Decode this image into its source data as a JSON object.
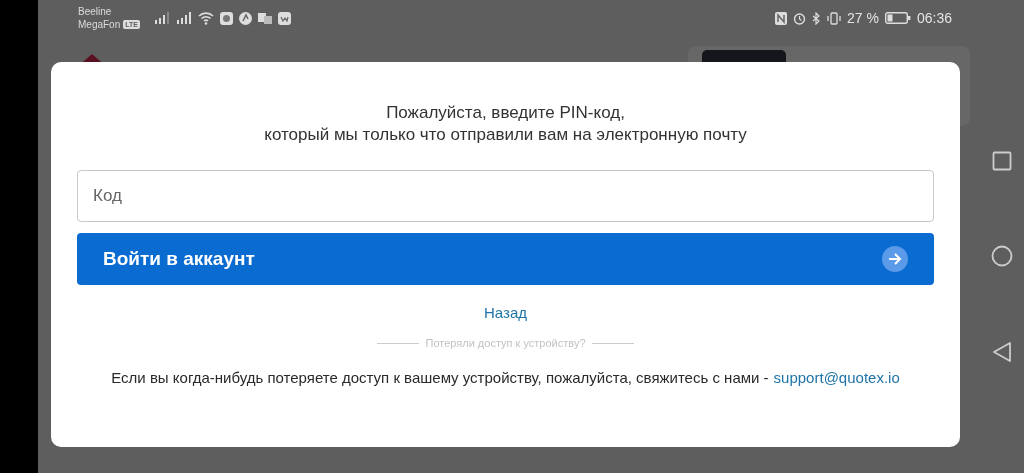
{
  "status_bar": {
    "carriers": [
      "Beeline",
      "MegaFon"
    ],
    "network_badge": "LTE",
    "battery_percent": "27 %",
    "time": "06:36"
  },
  "dialog": {
    "title_lines": [
      "Пожалуйста, введите PIN-код,",
      "который мы только что отправили вам на электронную почту"
    ],
    "code_field": {
      "placeholder": "Код"
    },
    "submit_button": "Войти в аккаунт",
    "back_link": "Назад",
    "divider_text": "Потеряли доступ к устройству?",
    "help_text": "Если вы когда-нибудь потеряете доступ к вашему устройству, пожалуйста, свяжитесь с нами -",
    "support_link": "support@quotex.io"
  }
}
